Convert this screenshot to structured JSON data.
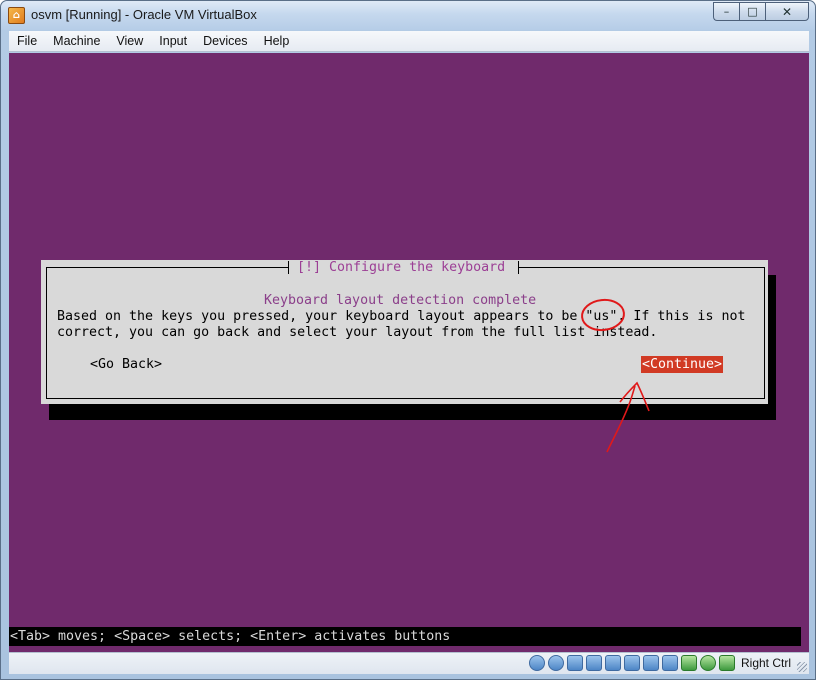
{
  "window": {
    "title": "osvm [Running] - Oracle VM VirtualBox",
    "controls": {
      "minimize": "–",
      "maximize": "□",
      "close": "✕"
    }
  },
  "menubar": {
    "items": [
      "File",
      "Machine",
      "View",
      "Input",
      "Devices",
      "Help"
    ]
  },
  "dialog": {
    "title": "[!] Configure the keyboard",
    "heading": "Keyboard layout detection complete",
    "line1": "Based on the keys you pressed, your keyboard layout appears to be \"us\". If this is not",
    "line2": "correct, you can go back and select your layout from the full list instead.",
    "back_button": "<Go Back>",
    "continue_button": "<Continue>"
  },
  "guest_status_line": "<Tab> moves; <Space> selects; <Enter> activates buttons",
  "statusbar": {
    "host_key": "Right Ctrl",
    "icons": [
      "hard-disk-icon",
      "optical-drive-icon",
      "audio-icon",
      "network-icon",
      "usb-icon",
      "shared-folders-icon",
      "display-icon",
      "video-capture-icon",
      "guest-additions-icon",
      "mouse-integration-icon",
      "keyboard-capture-icon"
    ]
  },
  "colors": {
    "guest_background": "#702a6c",
    "dialog_background": "#d9d9d9",
    "selected_button": "#d13a24",
    "annotation": "#e0191a"
  }
}
